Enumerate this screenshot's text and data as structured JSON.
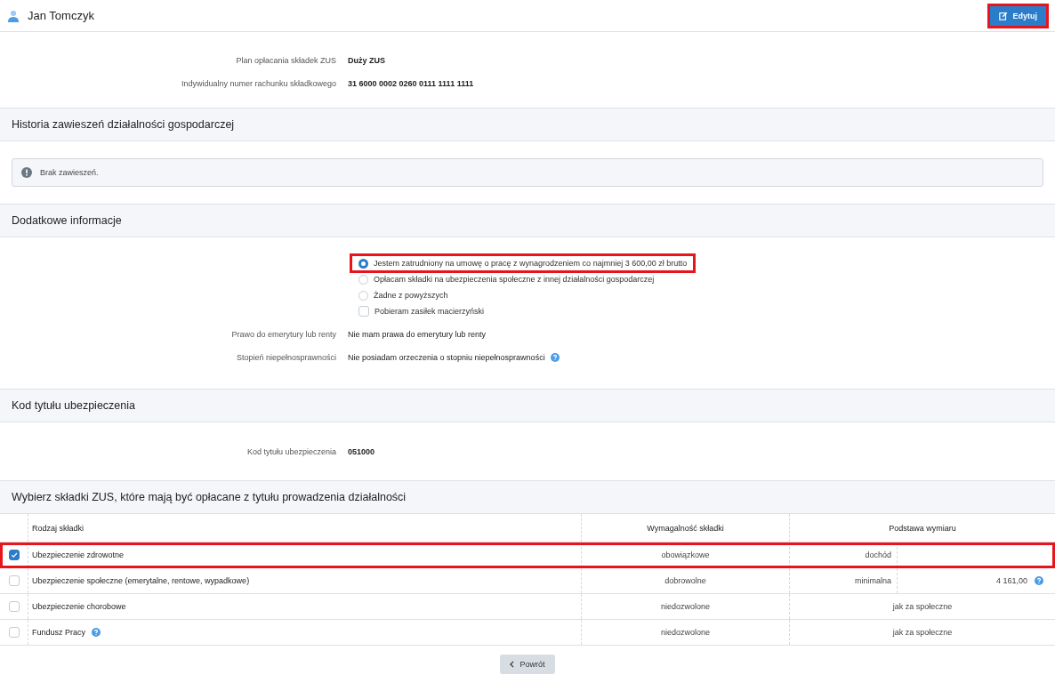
{
  "header": {
    "name": "Jan Tomczyk",
    "edit_button": {
      "label": "Edytuj",
      "highlighted": true
    }
  },
  "info": [
    {
      "label": "Plan opłacania składek ZUS",
      "value": "Duży ZUS"
    },
    {
      "label": "Indywidualny numer rachunku składkowego",
      "value": "31 6000 0002 0260 0111 1111 1111"
    }
  ],
  "suspensions": {
    "title": "Historia zawieszeń działalności gospodarczej",
    "message": "Brak zawieszeń."
  },
  "additional": {
    "title": "Dodatkowe informacje",
    "options": [
      {
        "kind": "radio",
        "label": "Jestem zatrudniony na umowę o pracę z wynagrodzeniem co najmniej 3 600,00 zł brutto",
        "selected": true,
        "highlighted": true
      },
      {
        "kind": "radio",
        "label": "Opłacam składki na ubezpieczenia społeczne z innej działalności gospodarczej",
        "selected": false,
        "highlighted": false
      },
      {
        "kind": "radio",
        "label": "Żadne z powyższych",
        "selected": false,
        "highlighted": false
      },
      {
        "kind": "checkbox",
        "label": "Pobieram zasiłek macierzyński",
        "selected": false,
        "highlighted": false
      }
    ],
    "fields": [
      {
        "label": "Prawo do emerytury lub renty",
        "value": "Nie mam prawa do emerytury lub renty",
        "help": false
      },
      {
        "label": "Stopień niepełnosprawności",
        "value": "Nie posiadam orzeczenia o stopniu niepełnosprawności",
        "help": true
      }
    ]
  },
  "insurance_code": {
    "title": "Kod tytułu ubezpieczenia",
    "label": "Kod tytułu ubezpieczenia",
    "value": "051000"
  },
  "contributions": {
    "title": "Wybierz składki ZUS, które mają być opłacane z tytułu prowadzenia działalności",
    "columns": [
      "Rodzaj składki",
      "Wymagalność składki",
      "Podstawa wymiaru"
    ],
    "rows": [
      {
        "kind": "split",
        "name": "Ubezpieczenie zdrowotne",
        "help": false,
        "checked": true,
        "highlighted": true,
        "requirement": "obowiązkowe",
        "basis": "dochód",
        "amount": "",
        "amount_help": false
      },
      {
        "kind": "split",
        "name": "Ubezpieczenie społeczne (emerytalne, rentowe, wypadkowe)",
        "help": false,
        "checked": false,
        "highlighted": false,
        "requirement": "dobrowolne",
        "basis": "minimalna",
        "amount": "4 161,00",
        "amount_help": true
      },
      {
        "kind": "merged",
        "name": "Ubezpieczenie chorobowe",
        "help": false,
        "checked": false,
        "highlighted": false,
        "requirement": "niedozwolone",
        "basis": "jak za społeczne"
      },
      {
        "kind": "merged",
        "name": "Fundusz Pracy",
        "help": true,
        "checked": false,
        "highlighted": false,
        "requirement": "niedozwolone",
        "basis": "jak za społeczne"
      }
    ]
  },
  "back_button": {
    "label": "Powrót"
  }
}
